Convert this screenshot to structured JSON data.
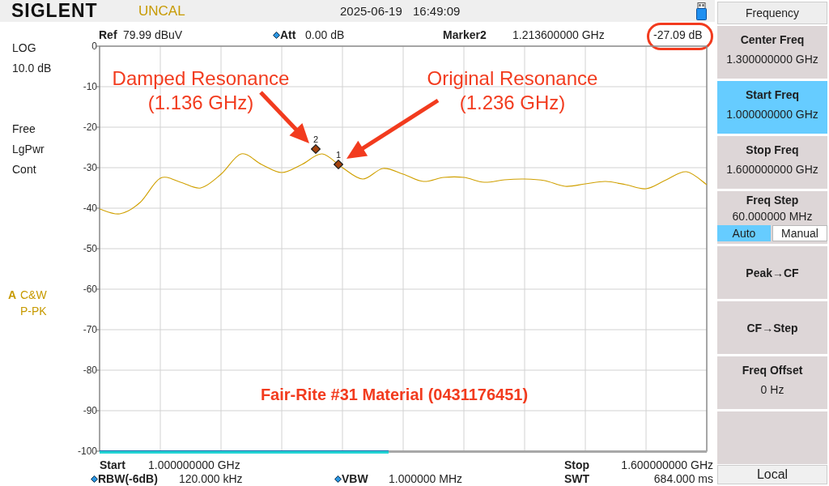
{
  "status_bar": {
    "logo": "SIGLENT",
    "status": "UNCAL",
    "date": "2025-06-19",
    "time": "16:49:09"
  },
  "readouts": [
    {
      "kind": "plain",
      "label": "Ref",
      "value": "79.99 dBuV"
    },
    {
      "kind": "adjustable",
      "label": "Att",
      "value": "0.00 dB"
    },
    {
      "kind": "marker",
      "label": "Marker2",
      "value": "1.213600000 GHz",
      "reading": "-27.09 dB",
      "circled": true
    }
  ],
  "left_status": {
    "groups": [
      {
        "lines": [
          "LOG",
          "10.0 dB"
        ]
      },
      {
        "lines": [
          "Free",
          "LgPwr",
          "Cont"
        ]
      }
    ],
    "trace": {
      "name": "A",
      "lines": [
        "C&W",
        "P-PK"
      ]
    }
  },
  "plot": {
    "chart_data": {
      "type": "line",
      "categories": [
        null,
        null,
        null,
        null,
        null,
        null,
        null,
        null,
        null,
        null,
        null,
        null,
        null,
        null,
        null,
        null,
        null,
        null,
        null,
        null,
        null,
        null,
        null,
        null,
        null,
        null,
        null,
        null,
        null,
        null,
        null
      ],
      "series": [
        {
          "color": "#d0a000",
          "values": [
            -40.2,
            -41.4,
            -38.6,
            -32.6,
            -33.6,
            -35.0,
            -31.6,
            -26.6,
            -29.2,
            -31.2,
            -29.2,
            -26.6,
            -30.0,
            -32.8,
            -30.2,
            -31.6,
            -33.4,
            -32.4,
            -32.4,
            -33.6,
            -33.0,
            -32.8,
            -33.2,
            -34.6,
            -34.0,
            -33.4,
            -34.2,
            -35.2,
            -33.0,
            -31.0,
            -34.2
          ]
        }
      ],
      "ylim": [
        -100,
        0
      ],
      "yticks": [
        {
          "value": 0,
          "label": "0"
        },
        {
          "value": -10,
          "label": "-10"
        },
        {
          "value": -20,
          "label": "-20"
        },
        {
          "value": -30,
          "label": "-30"
        },
        {
          "value": -40,
          "label": "-40"
        },
        {
          "value": -50,
          "label": "-50"
        },
        {
          "value": -60,
          "label": "-60"
        },
        {
          "value": -70,
          "label": "-70"
        },
        {
          "value": -80,
          "label": "-80"
        },
        {
          "value": -90,
          "label": "-90"
        },
        {
          "value": -100,
          "label": "-100"
        }
      ],
      "grid": true
    },
    "markers": [
      {
        "label": "2"
      },
      {
        "label": "1"
      }
    ],
    "sweep_progress": {
      "level": 0.476
    }
  },
  "bottom_readouts": [
    {
      "items": [
        {
          "kind": "plain",
          "label": "Start",
          "value": "1.000000000 GHz"
        },
        {
          "kind": "plain",
          "label": "Stop",
          "value": "1.600000000 GHz"
        }
      ]
    },
    {
      "items": [
        {
          "kind": "adjustable",
          "label": "RBW(-6dB)",
          "value": "120.000 kHz"
        },
        {
          "kind": "adjustable",
          "label": "VBW",
          "value": "1.000000 MHz"
        },
        {
          "kind": "plain",
          "label": "SWT",
          "value": "684.000 ms"
        }
      ]
    }
  ],
  "menu": {
    "title": "Frequency",
    "softkeys": [
      {
        "kind": "value",
        "label": "Center Freq",
        "value": "1.300000000 GHz",
        "selected": false
      },
      {
        "kind": "value",
        "label": "Start Freq",
        "value": "1.000000000 GHz",
        "selected": true
      },
      {
        "kind": "value",
        "label": "Stop Freq",
        "value": "1.600000000 GHz",
        "selected": false
      },
      {
        "kind": "toggle",
        "label": "Freq Step",
        "value": "60.000000 MHz",
        "selected": false,
        "options": [
          {
            "label": "Auto",
            "selected": true
          },
          {
            "label": "Manual",
            "selected": false
          }
        ]
      },
      {
        "kind": "action",
        "label": "Peak→CF",
        "selected": false
      },
      {
        "kind": "action",
        "label": "CF→Step",
        "selected": false
      },
      {
        "kind": "value",
        "label": "Freq Offset",
        "value": "0 Hz",
        "selected": false
      },
      {
        "kind": "empty",
        "selected": false
      }
    ],
    "footer": "Local"
  },
  "callouts": [
    {
      "lines": [
        "Damped Resonance",
        "(1.136 GHz)"
      ]
    },
    {
      "lines": [
        "Original Resonance",
        "(1.236 GHz)"
      ]
    }
  ],
  "caption": "Fair-Rite #31 Material (0431176451)"
}
